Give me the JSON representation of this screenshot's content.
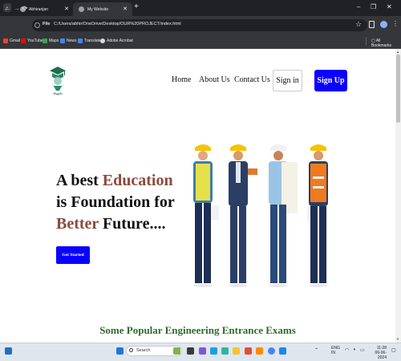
{
  "browser": {
    "tabs": [
      {
        "title": "Abhiranjan",
        "active": false
      },
      {
        "title": "My Website",
        "active": true
      }
    ],
    "new_tab": "+",
    "window_controls": {
      "minimize": "–",
      "restore": "❐",
      "close": "✕"
    },
    "address": {
      "scheme_label": "File",
      "url": "C:/Users/abhir/OneDrive/Desktop/OUR%20PROJECT/index.html"
    },
    "nav": {
      "back": "←",
      "forward": "→",
      "reload": "⟳"
    },
    "star": "☆",
    "menu": "⋮",
    "bookmarks": [
      {
        "label": "Gmail",
        "icon": "gmail-icon",
        "color": "#ea4335"
      },
      {
        "label": "YouTube",
        "icon": "youtube-icon",
        "color": "#ff0000"
      },
      {
        "label": "Maps",
        "icon": "maps-icon",
        "color": "#34a853"
      },
      {
        "label": "News",
        "icon": "news-icon",
        "color": "#4285f4"
      },
      {
        "label": "Translate",
        "icon": "translate-icon",
        "color": "#4285f4"
      },
      {
        "label": "Adobe Acrobat",
        "icon": "acrobat-icon",
        "color": "#d9d9d9"
      }
    ],
    "all_bookmarks": "All Bookmarks"
  },
  "site": {
    "nav_links": [
      "Home",
      "About Us",
      "Contact Us"
    ],
    "signin": "Sign in",
    "signup": "Sign Up",
    "hero": {
      "l1a": "A best ",
      "l1b": "Education",
      "l2": "is Foundation for",
      "l3a": "Better",
      "l3b": " Future...."
    },
    "cta": "Get Started",
    "section_title": "Some Popular Engineering Entrance Exams",
    "colors": {
      "accent": "#0a00ff",
      "hero_accent": "#8b4a3c",
      "section_title": "#2e6b2a"
    }
  },
  "taskbar": {
    "search_placeholder": "Search",
    "lang_line1": "ENG",
    "lang_line2": "IN",
    "time": "11:28",
    "date": "06-06-2024"
  }
}
